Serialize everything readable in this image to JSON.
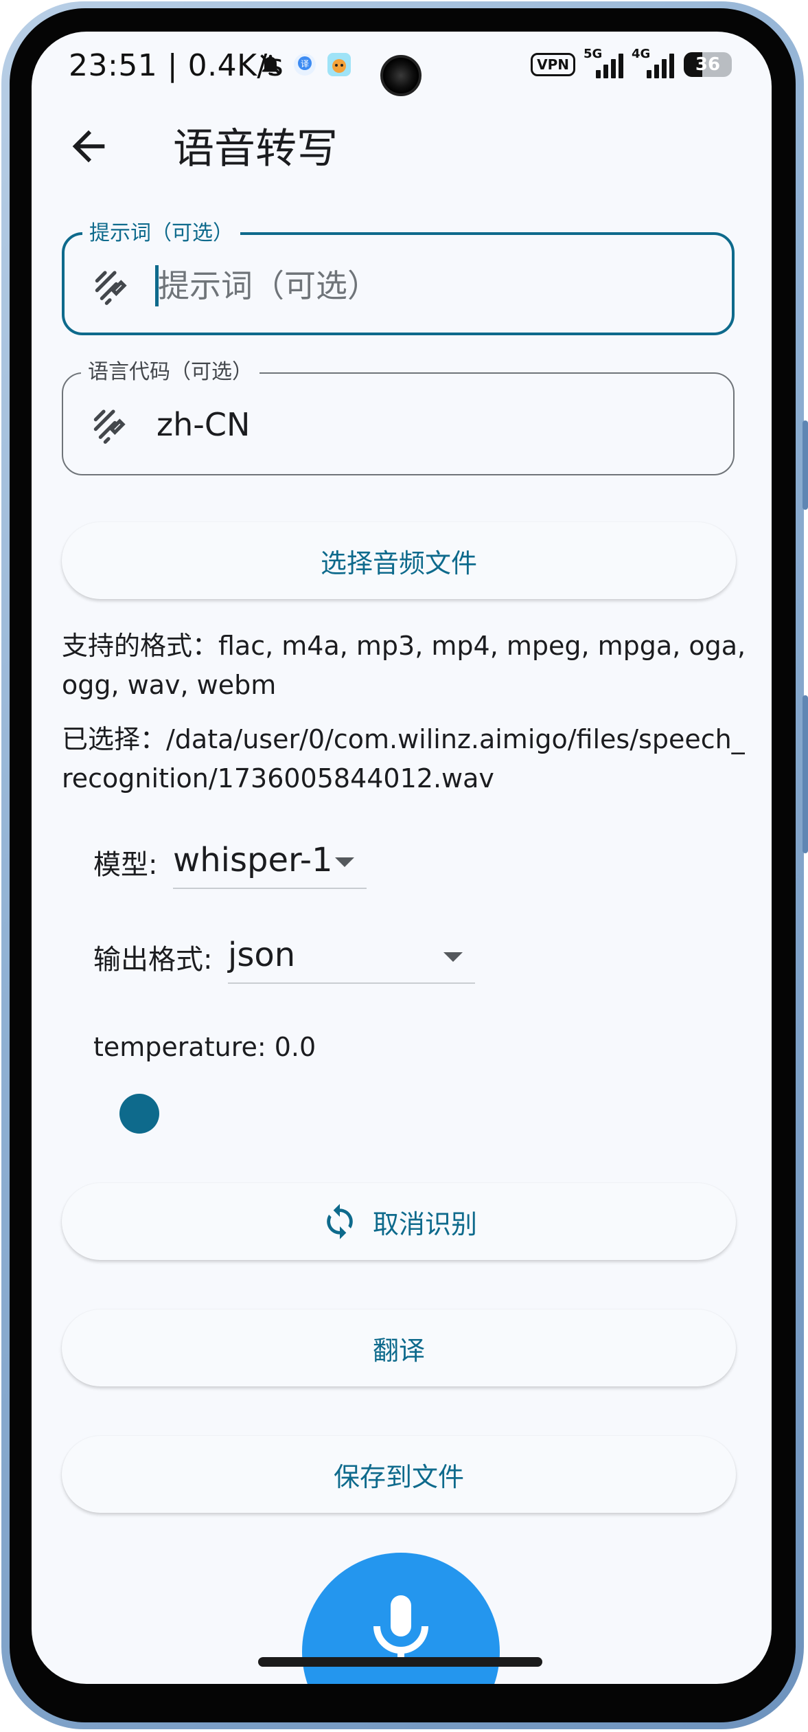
{
  "status_bar": {
    "time": "23:51 | 0.4K/s",
    "vpn": "VPN",
    "sim1_gen": "5G",
    "sim2_gen": "4G",
    "battery": "36"
  },
  "app_bar": {
    "back_icon": "arrow-left-icon",
    "title": "语音转写"
  },
  "prompt_field": {
    "label": "提示词（可选）",
    "placeholder": "提示词（可选）",
    "value": "",
    "icon": "edit-note-icon"
  },
  "language_field": {
    "label": "语言代码（可选）",
    "value": "zh-CN",
    "icon": "edit-note-icon"
  },
  "select_audio_button": {
    "label": "选择音频文件"
  },
  "supported_formats": "支持的格式：flac, m4a, mp3, mp4, mpeg, mpga, oga, ogg, wav, webm",
  "selected_file": "已选择：/data/user/0/com.wilinz.aimigo/files/speech_recognition/1736005844012.wav",
  "model": {
    "label": "模型:",
    "value": "whisper-1"
  },
  "output_format": {
    "label": "输出格式:",
    "value": "json"
  },
  "temperature": {
    "label": "temperature: 0.0",
    "value": 0.0
  },
  "cancel_button": {
    "label": "取消识别",
    "icon": "sync-icon"
  },
  "translate_button": {
    "label": "翻译"
  },
  "save_button": {
    "label": "保存到文件"
  },
  "mic_fab": {
    "icon": "microphone-icon"
  },
  "colors": {
    "primary": "#0e6a8c",
    "fab": "#2496ee",
    "background": "#f7f9fd"
  }
}
